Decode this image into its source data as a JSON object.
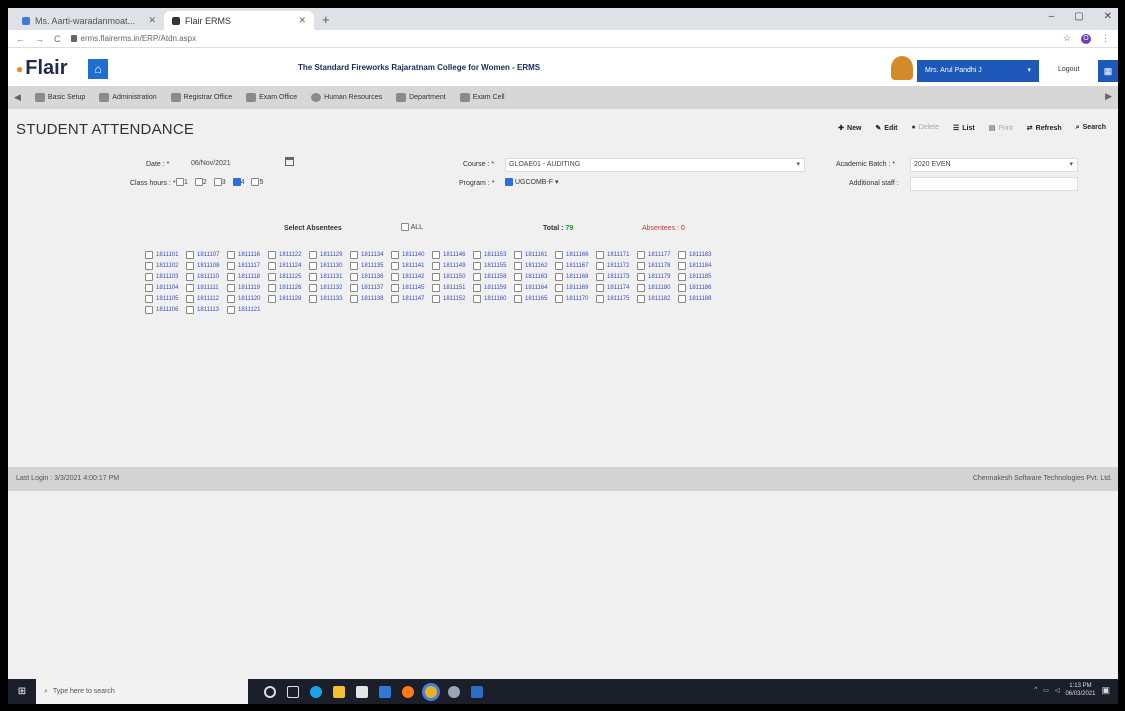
{
  "browser": {
    "tabs": [
      {
        "label": "Ms. Aarti-waradanmoat...",
        "active": false,
        "fav_color": "#3f7ad8"
      },
      {
        "label": "Flair ERMS",
        "active": true,
        "fav_color": "#333333"
      }
    ],
    "url": "erms.flairerms.in/ERP/Atdn.aspx",
    "profile_initial": "O"
  },
  "header": {
    "logo": "Flair",
    "college": "The Standard Fireworks Rajaratnam College for Women - ERMS",
    "user": "Mrs. Arul Pandhi J",
    "logout": "Logout"
  },
  "nav": {
    "modules": [
      "Basic Setup",
      "Administration",
      "Registrar Office",
      "Exam Office",
      "Human Resources",
      "Department",
      "Exam Cell"
    ]
  },
  "page": {
    "title": "STUDENT ATTENDANCE",
    "actions": [
      {
        "label": "New",
        "icon": "new-icon",
        "enabled": true
      },
      {
        "label": "Edit",
        "icon": "edit-icon",
        "enabled": true
      },
      {
        "label": "Delete",
        "icon": "delete-icon",
        "enabled": false
      },
      {
        "label": "List",
        "icon": "list-icon",
        "enabled": true
      },
      {
        "label": "Print",
        "icon": "print-icon",
        "enabled": false
      },
      {
        "label": "Refresh",
        "icon": "refresh-icon",
        "enabled": true
      },
      {
        "label": "Search",
        "icon": "search-icon",
        "enabled": true
      }
    ]
  },
  "form": {
    "date_label": "Date :",
    "date_value": "06/Nov/2021",
    "course_label": "Course :",
    "course_value": "GLOAE01 - AUDITING",
    "batch_label": "Academic Batch :",
    "batch_value": "2020 EVEN",
    "hours_label": "Class hours :",
    "hours": [
      {
        "n": "1",
        "checked": false
      },
      {
        "n": "2",
        "checked": false
      },
      {
        "n": "3",
        "checked": false
      },
      {
        "n": "4",
        "checked": true
      },
      {
        "n": "5",
        "checked": false
      }
    ],
    "program_label": "Program :",
    "program_value": "UGCOMB-F",
    "staff_label": "Additional staff :",
    "staff_value": ""
  },
  "absentees": {
    "select_label": "Select Absentees",
    "all_label": "ALL",
    "total_label": "Total :",
    "total_value": "79",
    "absent_label": "Absentees :",
    "absent_value": "0",
    "rolls": [
      [
        "1811101",
        "1811107",
        "1811116",
        "1811122",
        "1811129",
        "1811134",
        "1811140",
        "1811146",
        "1811153",
        "1811161",
        "1811166",
        "1811171",
        "1811177",
        "1811183"
      ],
      [
        "1811102",
        "1811108",
        "1811117",
        "1811124",
        "1811130",
        "1811135",
        "1811141",
        "1811149",
        "1811155",
        "1811162",
        "1811167",
        "1811172",
        "1811178",
        "1811184"
      ],
      [
        "1811103",
        "1811110",
        "1811118",
        "1811125",
        "1811131",
        "1811136",
        "1811142",
        "1811150",
        "1811158",
        "1811163",
        "1811168",
        "1811173",
        "1811179",
        "1811185"
      ],
      [
        "1811104",
        "1811111",
        "1811119",
        "1811126",
        "1811132",
        "1811137",
        "1811145",
        "1811151",
        "1811159",
        "1811164",
        "1811169",
        "1811174",
        "1811180",
        "1811186"
      ],
      [
        "1811105",
        "1811112",
        "1811120",
        "1811128",
        "1811133",
        "1811138",
        "1811147",
        "1811152",
        "1811160",
        "1811165",
        "1811170",
        "1811175",
        "1811182",
        "1811188"
      ],
      [
        "1811106",
        "1811113",
        "1811121"
      ]
    ]
  },
  "footer": {
    "last_login": "Last Login : 3/3/2021 4:00:17 PM",
    "company": "Chennakesh Software Technologies Pvt. Ltd."
  },
  "taskbar": {
    "search_placeholder": "Type here to search",
    "time": "1:13 PM",
    "date": "06/03/2021"
  }
}
